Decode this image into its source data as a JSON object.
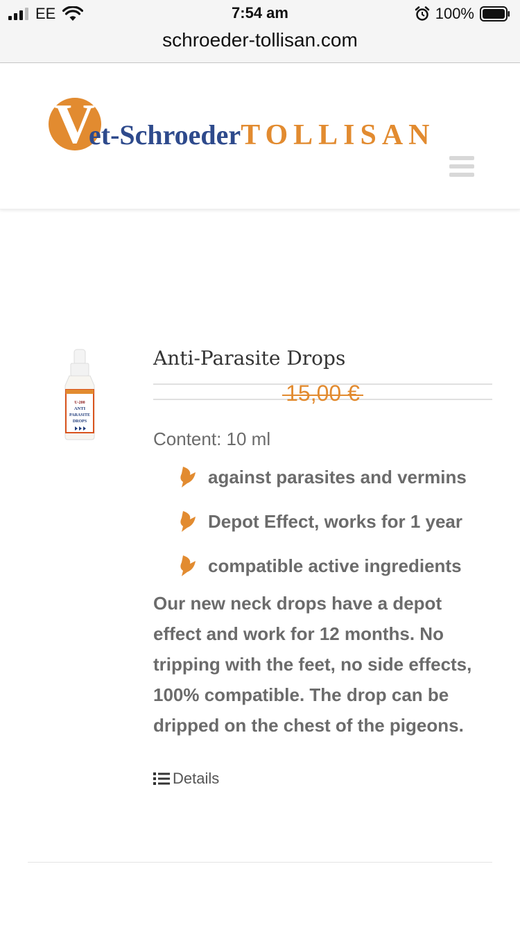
{
  "status_bar": {
    "carrier": "EE",
    "time": "7:54 am",
    "battery": "100%",
    "icons": [
      "signal-icon",
      "wifi-icon",
      "alarm-icon",
      "battery-icon"
    ]
  },
  "browser": {
    "url": "schroeder-tollisan.com"
  },
  "header": {
    "logo_letter": "V",
    "logo_part1": "et-Schroeder",
    "logo_part2": "TOLLISAN",
    "menu_icon": "hamburger-menu-icon"
  },
  "product": {
    "image_label": "U-200 ANTI PARASITE DROPS",
    "title": "Anti-Parasite Drops",
    "price": "15,00 €",
    "content": "Content: 10 ml",
    "features": [
      "against parasites and vermins",
      "Depot Effect, works for 1 year",
      "compatible active ingredients"
    ],
    "description": "Our new neck drops have a depot effect and work for 12 months. No tripping with the feet, no side effects, 100% compatible. The drop can be dripped on the chest of the pigeons.",
    "details_label": "Details"
  },
  "colors": {
    "accent_orange": "#e28b30",
    "logo_blue": "#2e4a8c",
    "text_gray": "#6b6b6b"
  }
}
